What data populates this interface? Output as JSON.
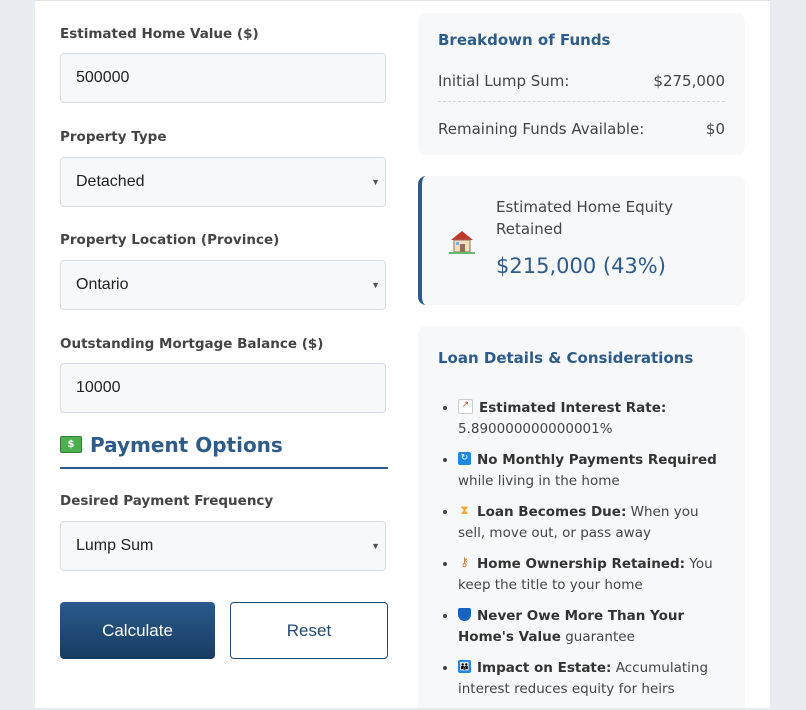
{
  "form": {
    "home_value": {
      "label": "Estimated Home Value ($)",
      "value": "500000"
    },
    "property_type": {
      "label": "Property Type",
      "value": "Detached"
    },
    "province": {
      "label": "Property Location (Province)",
      "value": "Ontario"
    },
    "mortgage": {
      "label": "Outstanding Mortgage Balance ($)",
      "value": "10000"
    },
    "payment_options_heading": "Payment Options",
    "payment_frequency": {
      "label": "Desired Payment Frequency",
      "value": "Lump Sum"
    },
    "calculate_label": "Calculate",
    "reset_label": "Reset"
  },
  "breakdown": {
    "title": "Breakdown of Funds",
    "rows": [
      {
        "label": "Initial Lump Sum:",
        "value": "$275,000"
      },
      {
        "label": "Remaining Funds Available:",
        "value": "$0"
      }
    ]
  },
  "equity": {
    "label": "Estimated Home Equity Retained",
    "value": "$215,000 (43%)",
    "icon": "house-icon"
  },
  "loan": {
    "title": "Loan Details & Considerations",
    "items": [
      {
        "icon": "chart-icon",
        "bold": "Estimated Interest Rate:",
        "text": "5.890000000000001%"
      },
      {
        "icon": "refresh-icon",
        "bold": "No Monthly Payments Required",
        "text": "while living in the home"
      },
      {
        "icon": "hourglass-icon",
        "bold": "Loan Becomes Due:",
        "text": "When you sell, move out, or pass away"
      },
      {
        "icon": "key-icon",
        "bold": "Home Ownership Retained:",
        "text": "You keep the title to your home"
      },
      {
        "icon": "shield-icon",
        "bold": "Never Owe More Than Your Home's Value",
        "text": "guarantee"
      },
      {
        "icon": "family-icon",
        "bold": "Impact on Estate:",
        "text": "Accumulating interest reduces equity for heirs"
      }
    ]
  },
  "colors": {
    "accent": "#2d5b8a",
    "panel": "#f7f8fa"
  }
}
